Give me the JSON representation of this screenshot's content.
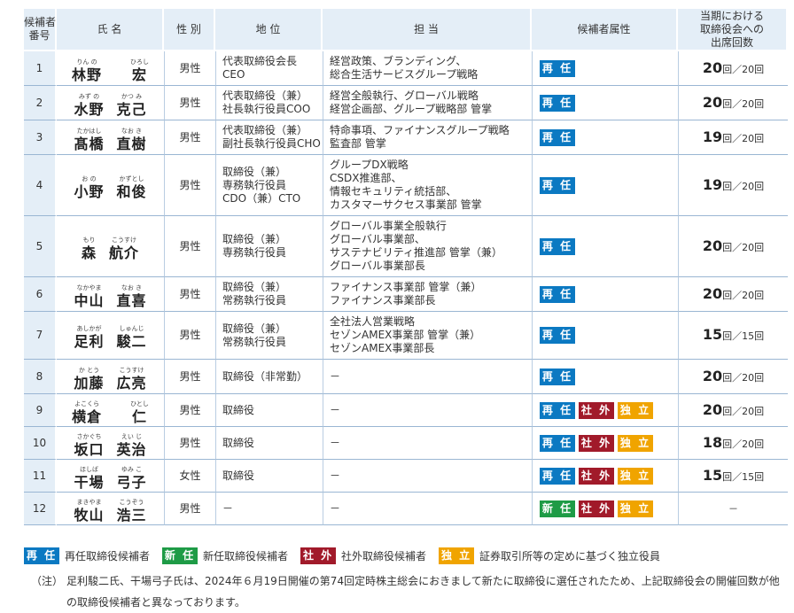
{
  "headers": {
    "no": [
      "候補者",
      "番号"
    ],
    "name": "氏 名",
    "gender": "性 別",
    "position": "地 位",
    "duty": "担 当",
    "attribute": "候補者属性",
    "attendance": [
      "当期における",
      "取締役会への",
      "出席回数"
    ]
  },
  "badge_labels": {
    "re": "再 任",
    "new": "新 任",
    "out": "社 外",
    "ind": "独 立"
  },
  "badge_colors": {
    "re": "#0b79c2",
    "new": "#1e9b46",
    "out": "#a11a2a",
    "ind": "#f0a400"
  },
  "rows": [
    {
      "no": "1",
      "furi1": "りん の",
      "furi2": "ひろし",
      "name1": "林野",
      "name2": "宏",
      "gender": "男性",
      "position": [
        "代表取締役会長",
        "CEO"
      ],
      "duty": [
        "経営政策、ブランディング、",
        "総合生活サービスグループ戦略"
      ],
      "badges": [
        "re"
      ],
      "att_num": "20",
      "att_unit": "回／20回"
    },
    {
      "no": "2",
      "furi1": "みず の",
      "furi2": "かつ み",
      "name1": "水野",
      "name2": "克己",
      "gender": "男性",
      "position": [
        "代表取締役（兼）",
        "社長執行役員COO"
      ],
      "duty": [
        "経営全般執行、グローバル戦略",
        "経営企画部、グループ戦略部 管掌"
      ],
      "badges": [
        "re"
      ],
      "att_num": "20",
      "att_unit": "回／20回"
    },
    {
      "no": "3",
      "furi1": "たかはし",
      "furi2": "なお き",
      "name1": "髙橋",
      "name2": "直樹",
      "gender": "男性",
      "position": [
        "代表取締役（兼）",
        "副社長執行役員CHO"
      ],
      "duty": [
        "特命事項、ファイナンスグループ戦略",
        "監査部 管掌"
      ],
      "badges": [
        "re"
      ],
      "att_num": "19",
      "att_unit": "回／20回"
    },
    {
      "no": "4",
      "furi1": "お の",
      "furi2": "かずとし",
      "name1": "小野",
      "name2": "和俊",
      "gender": "男性",
      "position": [
        "取締役（兼）",
        "専務執行役員",
        "CDO（兼）CTO"
      ],
      "duty": [
        "グループDX戦略",
        "CSDX推進部、",
        "情報セキュリティ統括部、",
        "カスタマーサクセス事業部 管掌"
      ],
      "badges": [
        "re"
      ],
      "att_num": "19",
      "att_unit": "回／20回"
    },
    {
      "no": "5",
      "furi1": "もり",
      "furi2": "こうすけ",
      "name1": "森",
      "name2": "航介",
      "gender": "男性",
      "position": [
        "取締役（兼）",
        "専務執行役員"
      ],
      "duty": [
        "グローバル事業全般執行",
        "グローバル事業部、",
        "サステナビリティ推進部 管掌（兼）",
        "グローバル事業部長"
      ],
      "badges": [
        "re"
      ],
      "att_num": "20",
      "att_unit": "回／20回"
    },
    {
      "no": "6",
      "furi1": "なかやま",
      "furi2": "なお き",
      "name1": "中山",
      "name2": "直喜",
      "gender": "男性",
      "position": [
        "取締役（兼）",
        "常務執行役員"
      ],
      "duty": [
        "ファイナンス事業部 管掌（兼）",
        "ファイナンス事業部長"
      ],
      "badges": [
        "re"
      ],
      "att_num": "20",
      "att_unit": "回／20回"
    },
    {
      "no": "7",
      "furi1": "あしかが",
      "furi2": "しゅんじ",
      "name1": "足利",
      "name2": "駿二",
      "gender": "男性",
      "position": [
        "取締役（兼）",
        "常務執行役員"
      ],
      "duty": [
        "全社法人営業戦略",
        "セゾンAMEX事業部 管掌（兼）",
        "セゾンAMEX事業部長"
      ],
      "badges": [
        "re"
      ],
      "att_num": "15",
      "att_unit": "回／15回"
    },
    {
      "no": "8",
      "furi1": "か とう",
      "furi2": "こうすけ",
      "name1": "加藤",
      "name2": "広亮",
      "gender": "男性",
      "position": [
        "取締役（非常勤）"
      ],
      "duty": [
        "－"
      ],
      "badges": [
        "re"
      ],
      "att_num": "20",
      "att_unit": "回／20回"
    },
    {
      "no": "9",
      "furi1": "よこくら",
      "furi2": "ひとし",
      "name1": "横倉",
      "name2": "仁",
      "gender": "男性",
      "position": [
        "取締役"
      ],
      "duty": [
        "－"
      ],
      "badges": [
        "re",
        "out",
        "ind"
      ],
      "att_num": "20",
      "att_unit": "回／20回"
    },
    {
      "no": "10",
      "furi1": "さかぐち",
      "furi2": "えい じ",
      "name1": "坂口",
      "name2": "英治",
      "gender": "男性",
      "position": [
        "取締役"
      ],
      "duty": [
        "－"
      ],
      "badges": [
        "re",
        "out",
        "ind"
      ],
      "att_num": "18",
      "att_unit": "回／20回"
    },
    {
      "no": "11",
      "furi1": "ほしば",
      "furi2": "ゆみ こ",
      "name1": "干場",
      "name2": "弓子",
      "gender": "女性",
      "position": [
        "取締役"
      ],
      "duty": [
        "－"
      ],
      "badges": [
        "re",
        "out",
        "ind"
      ],
      "att_num": "15",
      "att_unit": "回／15回"
    },
    {
      "no": "12",
      "furi1": "まきやま",
      "furi2": "こうぞう",
      "name1": "牧山",
      "name2": "浩三",
      "gender": "男性",
      "position": [
        "－"
      ],
      "duty": [
        "－"
      ],
      "badges": [
        "new",
        "out",
        "ind"
      ],
      "att_num": "",
      "att_unit": "－"
    }
  ],
  "legend": [
    {
      "badge": "re",
      "text": "再任取締役候補者"
    },
    {
      "badge": "new",
      "text": "新任取締役候補者"
    },
    {
      "badge": "out",
      "text": "社外取締役候補者"
    },
    {
      "badge": "ind",
      "text": "証券取引所等の定めに基づく独立役員"
    }
  ],
  "note": {
    "label": "（注）",
    "text": "足利駿二氏、干場弓子氏は、2024年６月19日開催の第74回定時株主総会におきまして新たに取締役に選任されたため、上記取締役会の開催回数が他の取締役候補者と異なっております。"
  }
}
